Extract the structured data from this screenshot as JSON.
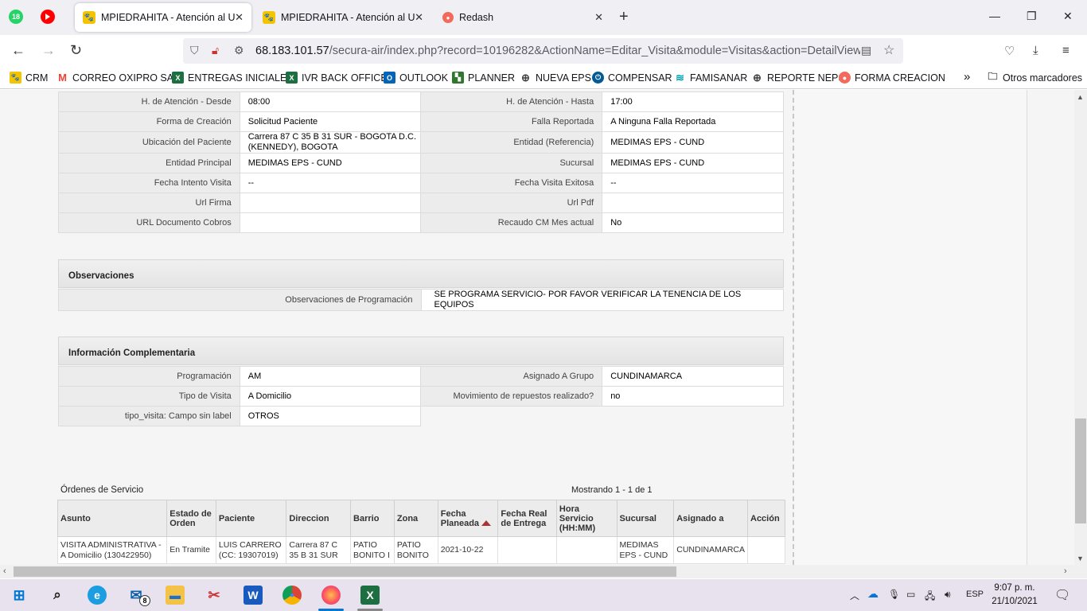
{
  "browser": {
    "pinned": [
      {
        "name": "whatsapp",
        "badge": "18"
      },
      {
        "name": "youtube",
        "badge": ""
      }
    ],
    "tabs": [
      {
        "title": "MPIEDRAHITA - Atención al Usu",
        "active": true
      },
      {
        "title": "MPIEDRAHITA - Atención al Usu",
        "active": false
      },
      {
        "title": "Redash",
        "active": false
      }
    ],
    "close_glyph": "✕",
    "new_tab_glyph": "+",
    "window_controls": [
      "—",
      "❐",
      "✕"
    ],
    "url_host": "68.183.101.57",
    "url_path": "/secura-air/index.php?record=10196282&ActionName=Editar_Visita&module=Visitas&action=DetailView&re",
    "bookmarks": [
      {
        "label": "CRM",
        "icon": "paw-icon",
        "color": "#f5c400"
      },
      {
        "label": "CORREO OXIPRO SAS",
        "icon": "gmail-icon",
        "color": "#ea4335"
      },
      {
        "label": "ENTREGAS INICIALES",
        "icon": "excel-icon",
        "color": "#1d6f42"
      },
      {
        "label": "IVR BACK OFFICE",
        "icon": "excel-icon",
        "color": "#1d6f42"
      },
      {
        "label": "OUTLOOK",
        "icon": "outlook-icon",
        "color": "#0364b8"
      },
      {
        "label": "PLANNER",
        "icon": "planner-icon",
        "color": "#31752f"
      },
      {
        "label": "NUEVA EPS",
        "icon": "globe-icon",
        "color": "#444444"
      },
      {
        "label": "COMPENSAR",
        "icon": "compensar-icon",
        "color": "#005b96"
      },
      {
        "label": "FAMISANAR",
        "icon": "famisanar-icon",
        "color": "#00a3b4"
      },
      {
        "label": "REPORTE NEPS",
        "icon": "globe-icon",
        "color": "#444444"
      },
      {
        "label": "FORMA CREACION",
        "icon": "redash-icon",
        "color": "#f26a5c"
      }
    ],
    "other_bookmarks": "Otros marcadores"
  },
  "detail": {
    "rows": [
      [
        "H. de Atención - Desde",
        "08:00",
        "H. de Atención - Hasta",
        "17:00"
      ],
      [
        "Forma de Creación",
        "Solicitud Paciente",
        "Falla Reportada",
        "A Ninguna Falla Reportada"
      ],
      [
        "Ubicación del Paciente",
        "Carrera 87 C 35 B 31 SUR - BOGOTA D.C. (KENNEDY), BOGOTA",
        "Entidad (Referencia)",
        "MEDIMAS EPS - CUND"
      ],
      [
        "Entidad Principal",
        "MEDIMAS EPS - CUND",
        "Sucursal",
        "MEDIMAS EPS - CUND"
      ],
      [
        "Fecha Intento Visita",
        " --",
        "Fecha Visita Exitosa",
        " --"
      ],
      [
        "Url Firma",
        "",
        "Url Pdf",
        ""
      ],
      [
        "URL Documento Cobros",
        "",
        "Recaudo CM Mes actual",
        "No"
      ]
    ]
  },
  "observaciones": {
    "title": "Observaciones",
    "label": "Observaciones de Programación",
    "value": "SE PROGRAMA SERVICIO- POR FAVOR VERIFICAR LA TENENCIA DE LOS EQUIPOS"
  },
  "complementaria": {
    "title": "Información Complementaria",
    "rows": [
      [
        "Programación",
        "AM",
        "Asignado A Grupo",
        "CUNDINAMARCA"
      ],
      [
        "Tipo de Visita",
        "A Domicilio",
        "Movimiento de repuestos realizado?",
        " no"
      ],
      [
        "tipo_visita: Campo sin label",
        "OTROS"
      ]
    ]
  },
  "orders": {
    "title": "Órdenes de Servicio",
    "count": "Mostrando 1 - 1 de 1",
    "headers": [
      "Asunto",
      "Estado de Orden",
      "Paciente",
      "Direccion",
      "Barrio",
      "Zona",
      "Fecha Planeada",
      "Fecha Real de Entrega",
      "Hora Servicio (HH:MM)",
      "Sucursal",
      "Asignado a",
      "Acción"
    ],
    "rows": [
      [
        "VISITA ADMINISTRATIVA - A Domicilio (130422950)",
        "En Tramite",
        "LUIS CARRERO (CC: 19307019)",
        "Carrera 87 C 35 B 31 SUR",
        "PATIO BONITO I",
        "PATIO BONITO",
        "2021-10-22",
        "",
        "",
        "MEDIMAS EPS - CUND",
        "CUNDINAMARCA",
        ""
      ]
    ]
  },
  "taskbar": {
    "mail_badge": "8",
    "lang": "ESP",
    "time": "9:07 p. m.",
    "date": "21/10/2021"
  }
}
